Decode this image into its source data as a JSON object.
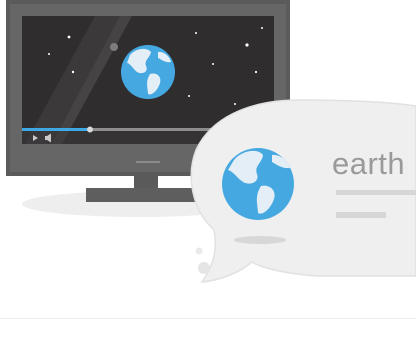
{
  "illustration": {
    "caption_word": "earth"
  },
  "colors": {
    "monitor_frame": "#5b5b5b",
    "screen_bg": "#2f2d2e",
    "globe_ocean": "#45a8e0",
    "globe_land": "#e4eef6",
    "progress_played": "#3fa9e6",
    "bubble_fill": "#efefef",
    "text_gray": "#9a9a9a"
  },
  "icons": [
    "monitor-icon",
    "globe-icon",
    "play-icon",
    "volume-icon",
    "speech-bubble-icon"
  ],
  "video": {
    "progress": 0.27
  }
}
